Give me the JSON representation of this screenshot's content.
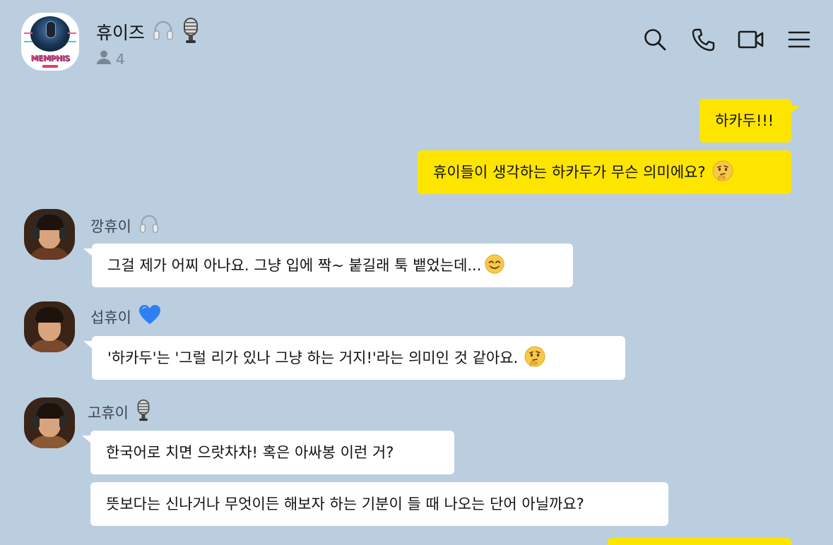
{
  "header": {
    "room_name": "휴이즈",
    "room_avatar_logo": "MEMPHIS",
    "member_count": "4",
    "icons": [
      "headphones-icon",
      "microphone-icon"
    ],
    "actions": [
      "search-icon",
      "phone-icon",
      "video-call-icon",
      "menu-icon"
    ]
  },
  "messages": {
    "mine_1": "하카두!!!",
    "mine_2": "휴이들이 생각하는 하카두가 무슨 의미에요?",
    "sender_1": "깡휴이",
    "theirs_1": "그걸 제가 어찌 아나요. 그냥 입에 짝~ 붙길래 툭 뱉었는데...",
    "sender_2": "섭휴이",
    "theirs_2": "'하카두'는 '그럴 리가 있나 그냥 하는 거지!'라는 의미인 것 같아요.",
    "sender_3": "고휴이",
    "theirs_3": "한국어로 치면 으랏차차! 혹은 아싸봉 이런 거?",
    "theirs_4": "뜻보다는 신나거나 무엇이든 해보자 하는 기분이 들 때 나오는 단어 아닐까요?"
  },
  "colors": {
    "background": "#bacee0",
    "my_bubble": "#fee500",
    "their_bubble": "#ffffff"
  }
}
